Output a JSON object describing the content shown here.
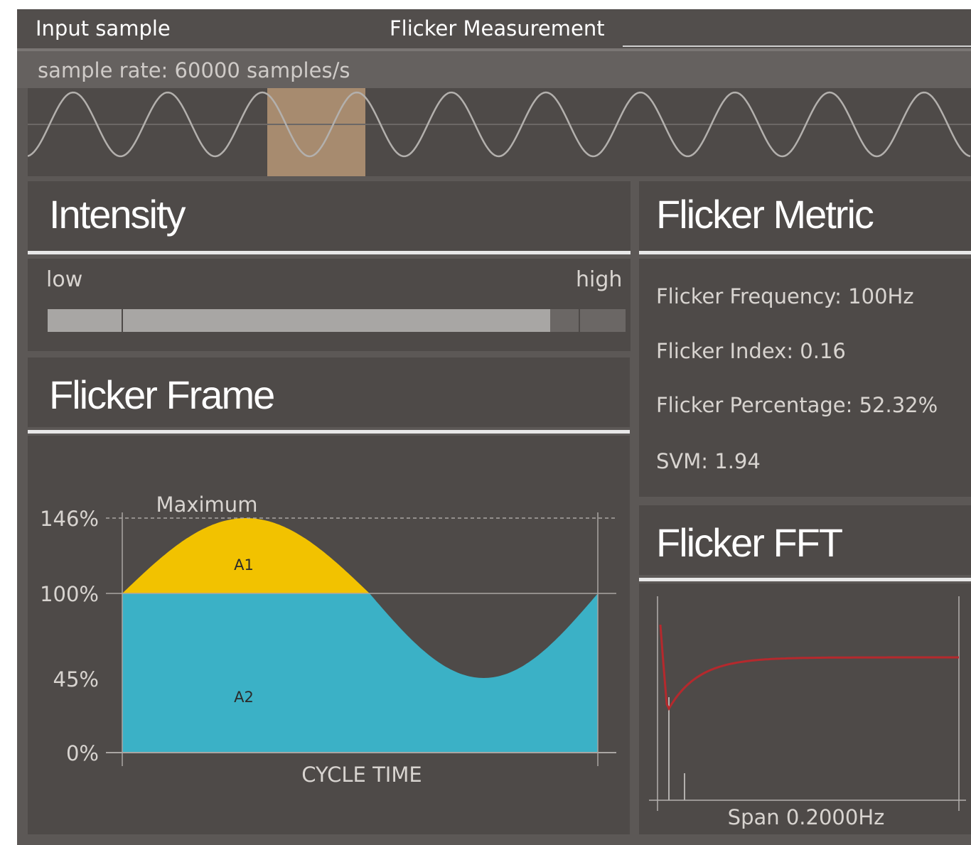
{
  "header": {
    "left_title": "Input sample",
    "center_title": "Flicker Measurement",
    "sample_rate": "sample rate: 60000 samples/s"
  },
  "intensity": {
    "title": "Intensity",
    "low_label": "low",
    "high_label": "high",
    "level_fraction": 0.87
  },
  "flicker_frame": {
    "title": "Flicker Frame",
    "max_label": "Maximum",
    "y_ticks": [
      "146%",
      "100%",
      "45%",
      "0%"
    ],
    "x_label": "CYCLE TIME",
    "area_labels": [
      "A1",
      "A2"
    ]
  },
  "flicker_metric": {
    "title": "Flicker Metric",
    "frequency": "Flicker Frequency: 100Hz",
    "index": "Flicker Index: 0.16",
    "percentage": "Flicker Percentage: 52.32%",
    "svm": "SVM: 1.94"
  },
  "flicker_fft": {
    "title": "Flicker FFT",
    "span_label": "Span 0.2000Hz"
  },
  "colors": {
    "a1_fill": "#f2c200",
    "a2_fill": "#3bb1c6",
    "fft_curve": "#b5292d",
    "selection": "#a78b6f"
  }
}
